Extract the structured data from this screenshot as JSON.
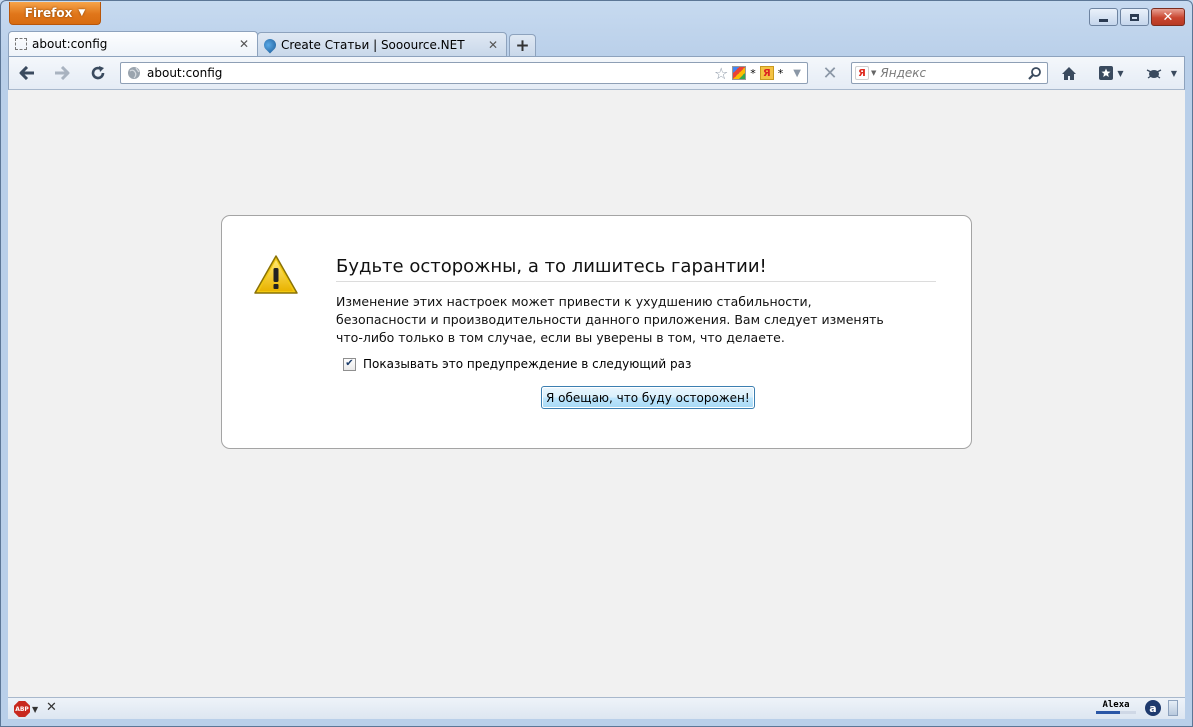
{
  "app": {
    "menu_button": "Firefox",
    "colors": {
      "accent": "#e0761a",
      "frame": "#b9cfe9",
      "close": "#c9452f"
    }
  },
  "window_controls": {
    "minimize": "minimize-icon",
    "maximize": "maximize-icon",
    "close": "close-icon"
  },
  "tabs": [
    {
      "title": "about:config",
      "selected": true
    },
    {
      "title": "Create Статьи | Sooource.NET",
      "selected": false
    }
  ],
  "toolbar": {
    "url": "about:config",
    "google_suffix": "*",
    "yandex_suffix": "*",
    "search_placeholder": "Яндекс",
    "yandex_letter": "Я"
  },
  "dialog": {
    "title": "Будьте осторожны, а то лишитесь гарантии!",
    "message": "Изменение этих настроек может привести к ухудшению стабильности, безопасности и производительности данного приложения. Вам следует изменять что-либо только в том случае, если вы уверены в том, что делаете.",
    "checkbox_label": "Показывать это предупреждение в следующий раз",
    "checkbox_checked": true,
    "button_label": "Я обещаю, что буду осторожен!"
  },
  "statusbar": {
    "abp_label": "ABP",
    "alexa_label": "Alexa",
    "a_label": "a"
  }
}
